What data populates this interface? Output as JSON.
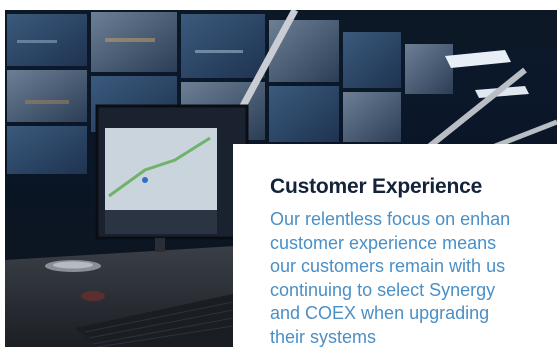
{
  "hero": {
    "photo_alt": "Control room with video wall of surveillance screens, a workstation monitor showing a map, and a keyboard",
    "icon": "surveillance-control-room"
  },
  "card": {
    "title": "Customer Experience",
    "body": "Our relentless focus on enhan\ncustomer experience means\nour customers remain with us\ncontinuing to select Synergy\nand COEX when upgrading\ntheir systems",
    "title_color": "#15233a",
    "body_color": "#4a8fc6"
  }
}
